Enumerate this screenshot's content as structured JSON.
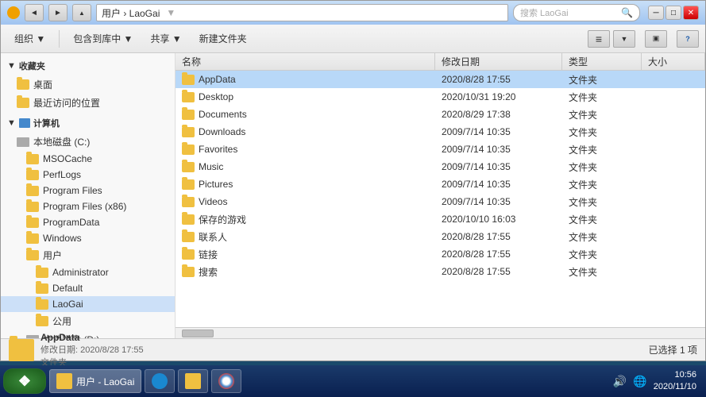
{
  "window": {
    "title": "LaoGai",
    "addressPath": "用户 › LaoGai",
    "searchPlaceholder": "搜索 LaoGai"
  },
  "toolbar": {
    "organize": "组织 ▼",
    "includeLibrary": "包含到库中 ▼",
    "share": "共享 ▼",
    "newFolder": "新建文件夹"
  },
  "sidebar": {
    "favoriteItems": [
      {
        "label": "桌面"
      },
      {
        "label": "最近访问的位置"
      }
    ],
    "computerLabel": "计算机",
    "computerItems": [
      {
        "label": "本地磁盘 (C:)"
      },
      {
        "label": "MSOCache"
      },
      {
        "label": "PerfLogs"
      },
      {
        "label": "Program Files"
      },
      {
        "label": "Program Files (x86)"
      },
      {
        "label": "ProgramData"
      },
      {
        "label": "Windows"
      },
      {
        "label": "用户"
      },
      {
        "label": "Administrator"
      },
      {
        "label": "Default"
      },
      {
        "label": "LaoGai",
        "selected": true
      },
      {
        "label": "公用"
      },
      {
        "label": "本地磁盘 (D:)"
      }
    ]
  },
  "fileList": {
    "columns": {
      "name": "名称",
      "date": "修改日期",
      "type": "类型",
      "size": "大小"
    },
    "files": [
      {
        "name": "AppData",
        "date": "2020/8/28 17:55",
        "type": "文件夹",
        "size": "",
        "selected": true
      },
      {
        "name": "Desktop",
        "date": "2020/10/31 19:20",
        "type": "文件夹",
        "size": ""
      },
      {
        "name": "Documents",
        "date": "2020/8/29 17:38",
        "type": "文件夹",
        "size": ""
      },
      {
        "name": "Downloads",
        "date": "2009/7/14 10:35",
        "type": "文件夹",
        "size": ""
      },
      {
        "name": "Favorites",
        "date": "2009/7/14 10:35",
        "type": "文件夹",
        "size": ""
      },
      {
        "name": "Music",
        "date": "2009/7/14 10:35",
        "type": "文件夹",
        "size": ""
      },
      {
        "name": "Pictures",
        "date": "2009/7/14 10:35",
        "type": "文件夹",
        "size": ""
      },
      {
        "name": "Videos",
        "date": "2009/7/14 10:35",
        "type": "文件夹",
        "size": ""
      },
      {
        "name": "保存的游戏",
        "date": "2020/10/10 16:03",
        "type": "文件夹",
        "size": ""
      },
      {
        "name": "联系人",
        "date": "2020/8/28 17:55",
        "type": "文件夹",
        "size": ""
      },
      {
        "name": "链接",
        "date": "2020/8/28 17:55",
        "type": "文件夹",
        "size": ""
      },
      {
        "name": "搜索",
        "date": "2020/8/28 17:55",
        "type": "文件夹",
        "size": ""
      }
    ]
  },
  "statusBar": {
    "selectedText": "已选择 1 项",
    "previewName": "AppData",
    "previewDate": "修改日期: 2020/8/28 17:55",
    "previewType": "文件夹"
  },
  "taskbar": {
    "startLabel": "❖",
    "items": [
      {
        "label": "用户 - LaoGai",
        "active": true
      }
    ],
    "clock": {
      "time": "10:56",
      "date": "2020/11/10"
    }
  }
}
